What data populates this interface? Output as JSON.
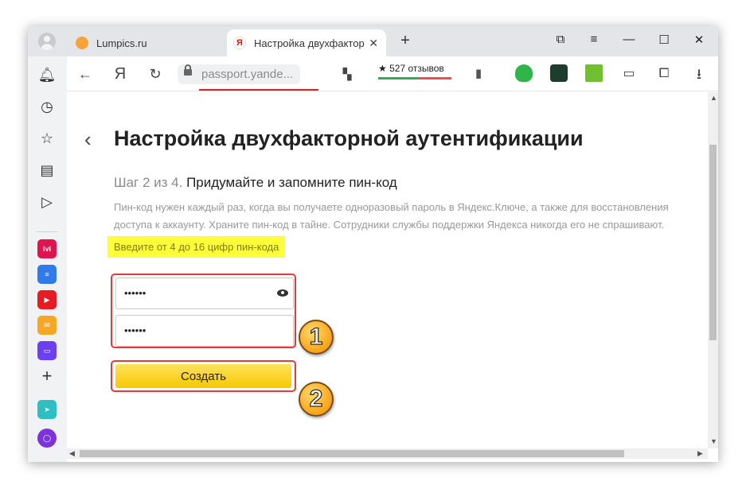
{
  "tabs": [
    {
      "title": "Lumpics.ru",
      "active": false
    },
    {
      "title": "Настройка двухфактор",
      "active": true,
      "favicon": "Я"
    }
  ],
  "toolbar": {
    "yandex_logo": "Я",
    "address": "passport.yande...",
    "reviews": "★ 527 отзывов"
  },
  "page": {
    "title": "Настройка двухфакторной аутентификации",
    "step_number": "Шаг 2 из 4.",
    "step_title": "Придумайте и запомните пин-код",
    "description": "Пин-код нужен каждый раз, когда вы получаете одноразовый пароль в Яндекс.Ключе, а также для восстановления доступа к аккаунту. Храните пин-код в тайне. Сотрудники службы поддержки Яндекса никогда его не спрашивают.",
    "hint": "Введите от 4 до 16 цифр пин-кода",
    "pin_value": "••••••",
    "pin_confirm_value": "••••••",
    "create_button": "Создать"
  },
  "annotations": {
    "badge_1": "1",
    "badge_2": "2"
  },
  "sidebar_apps": [
    "ivi",
    "docs",
    "youtube",
    "mail",
    "messenger",
    "add",
    "telegram",
    "alice"
  ],
  "colors": {
    "highlight": "#fdfd3a",
    "accent_red": "#e43a3a",
    "button_yellow": "#ffdb4d"
  }
}
